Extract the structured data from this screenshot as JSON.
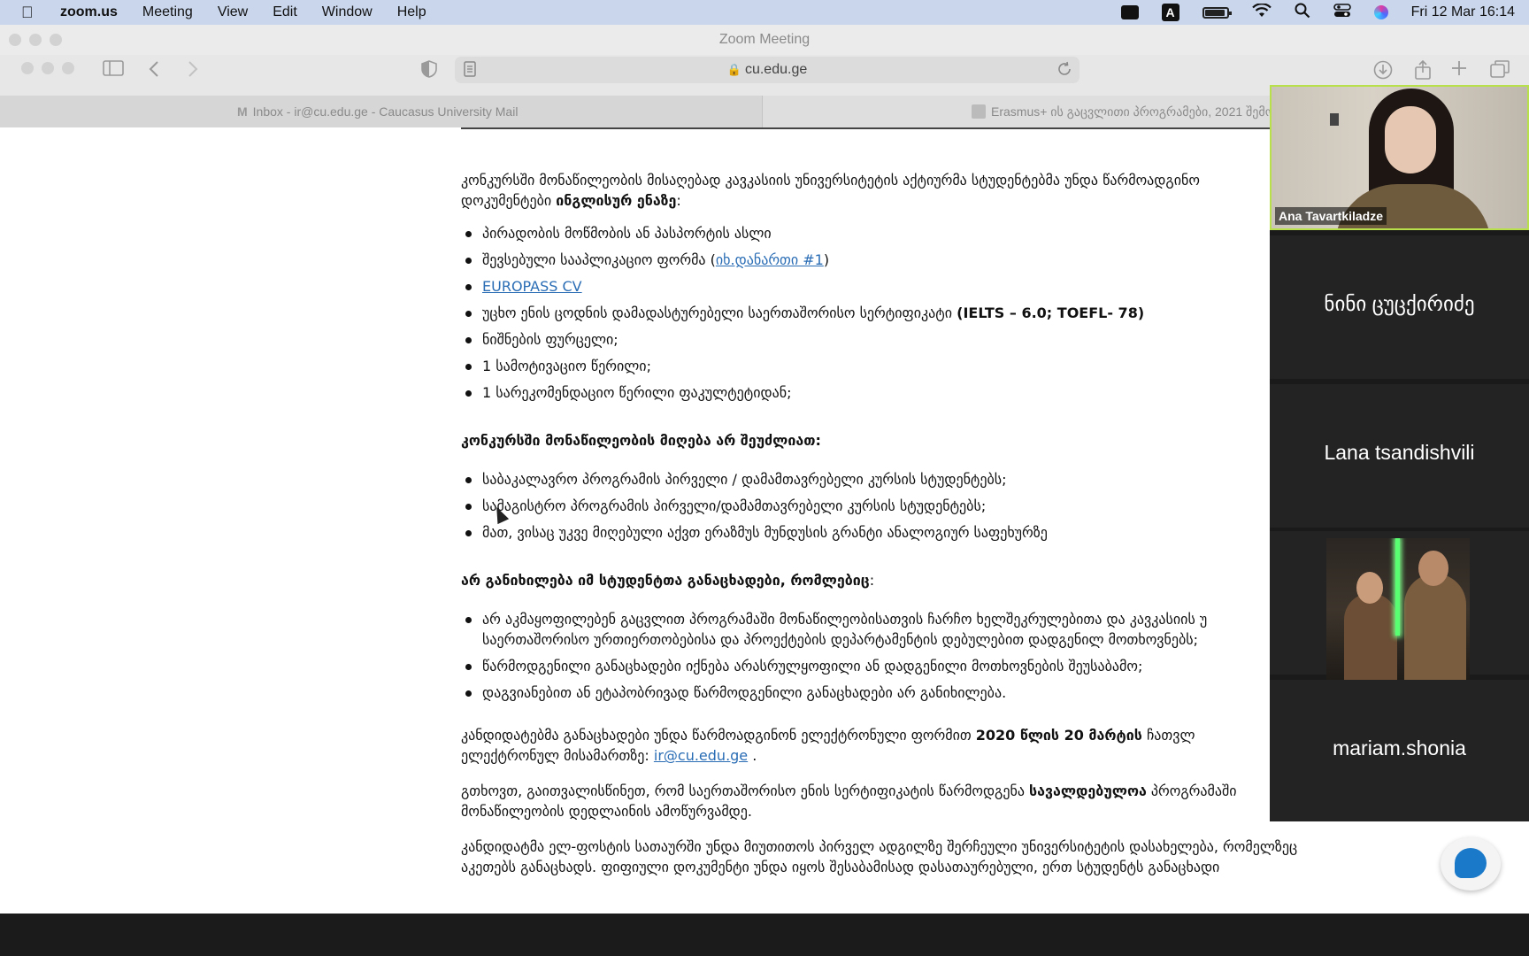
{
  "menubar": {
    "app": "zoom.us",
    "items": [
      "Meeting",
      "View",
      "Edit",
      "Window",
      "Help"
    ],
    "clock": "Fri 12 Mar  16:14",
    "icons": [
      "zoom-camera-icon",
      "input-source-icon",
      "battery-icon",
      "wifi-icon",
      "spotlight-search-icon",
      "control-center-icon",
      "siri-icon"
    ],
    "input_source_letter": "A"
  },
  "zoom_window": {
    "title": "Zoom Meeting"
  },
  "browser": {
    "url": "cu.edu.ge",
    "tabs": [
      {
        "label": "Inbox - ir@cu.edu.ge - Caucasus University Mail"
      },
      {
        "label": "Erasmus+ ის გაცვლითი პროგრამები, 2021 შემოდგომ"
      }
    ]
  },
  "page": {
    "intro": "კონკურსში მონაწილეობის მისაღებად კავკასიის უნივერსიტეტის აქტიურმა  სტუდენტებმა უნდა წარმოადგინო",
    "intro2_a": "დოკუმენტები ",
    "intro2_b": "ინგლისურ ენაზე",
    "intro2_c": ":",
    "docs": [
      "პირადობის მოწმობის ან პასპორტის ასლი",
      "შევსებული სააპლიკაციო ფორმა (",
      "",
      "უცხო ენის ცოდნის დამადასტურებელი საერთაშორისო სერტიფიკატი ",
      "ნიშნების ფურცელი;",
      "1 სამოტივაციო წერილი;",
      "1 სარეკომენდაციო წერილი ფაკულტეტიდან;"
    ],
    "doc2_link": "იხ.დანართი #1",
    "doc2_end": ")",
    "doc3_link": "EUROPASS CV",
    "doc4_bold": "(IELTS – 6.0; TOEFL- 78)",
    "cannot_heading": "კონკურსში მონაწილეობის მიღება  არ  შეუძლიათ:",
    "cannot": [
      "საბაკალავრო პროგრამის პირველი / დამამთავრებელი კურსის სტუდენტებს;",
      "სამაგისტრო პროგრამის პირველი/დამამთავრებელი კურსის სტუდენტებს;",
      "მათ, ვისაც უკვე მიღებული აქვთ ერაზმუს მუნდუსის გრანტი ანალოგიურ საფეხურზე"
    ],
    "notconsidered_heading_bold": "არ განიხილება იმ სტუდენტთა განაცხადები, რომლებიც",
    "notconsidered_heading_end": ":",
    "notconsidered": [
      "არ აკმაყოფილებენ გაცვლით პროგრამაში მონაწილეობისათვის ჩარჩო ხელშეკრულებითა და კავკასიის უ",
      "წარმოდგენილი განაცხადები იქნება არასრულყოფილი ან დადგენილი მოთხოვნების შეუსაბამო;",
      "დაგვიანებით ან ეტაპობრივად წარმოდგენილი განაცხადები არ განიხილება."
    ],
    "notconsidered_1_line2": "საერთაშორისო ურთიერთობებისა და პროექტების დეპარტამენტის დებულებით დადგენილ მოთხოვნებს;",
    "deadline_a": "კანდიდატებმა  განაცხადები უნდა წარმოადგინონ  ელექტრონული ფორმით ",
    "deadline_bold": "2020 წლის 20 მარტის",
    "deadline_b": "   ჩათვლ",
    "deadline_line2": "ელექტრონულ მისამართზე: ",
    "deadline_email": "ir@cu.edu.ge",
    "deadline_end": " .",
    "note_a": "გთხოვთ, გაითვალისწინეთ, რომ საერთაშორისო ენის სერტიფიკატის წარმოდგენა ",
    "note_bold": "სავალდებულოა",
    "note_b": " პროგრამაში",
    "note_line2": "მონაწილეობის დედლაინის ამოწურვამდე.",
    "last_line1": "კანდიდატმა ელ-ფოსტის სათაურში უნდა მიუთითოს პირველ ადგილზე შერჩეული  უნივერსიტეტის დასახელება, რომელზეც",
    "last_line2": "აკეთებს  განაცხადს. ფიფიული დოკუმენტი უნდა იყოს შესაბამისად დასათაურებული, ერთ სტუდენტს განაცხადი"
  },
  "participants": [
    {
      "name": "Ana Tavartkiladze",
      "video": true
    },
    {
      "name": "ნინი ცუცქირიძე"
    },
    {
      "name": "Lana tsandishvili"
    },
    {
      "name": "",
      "image": "jedi-profile-picture"
    },
    {
      "name": "mariam.shonia"
    }
  ],
  "colors": {
    "active_speaker": "#b8e04a",
    "link": "#2a6db5",
    "menubar": "#c9d6ec"
  }
}
